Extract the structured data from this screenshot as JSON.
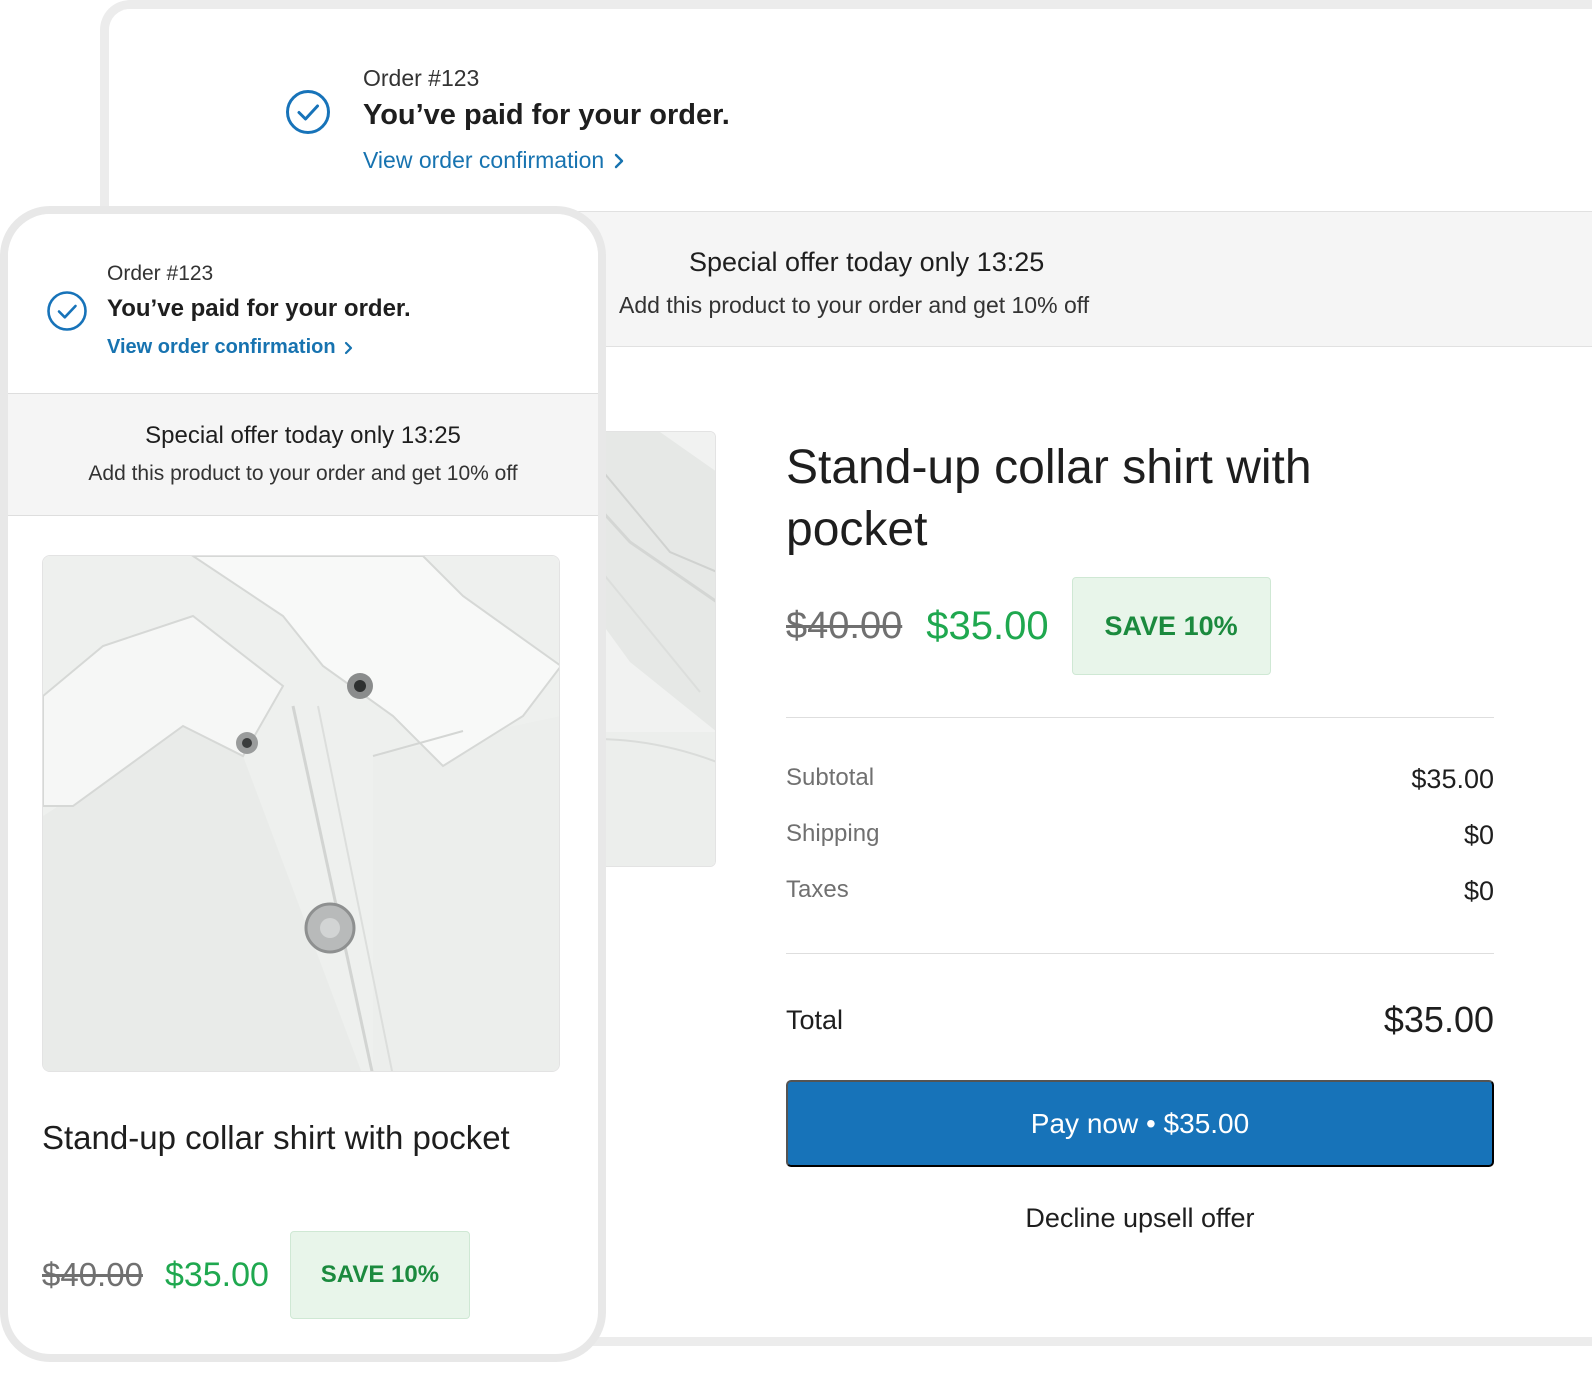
{
  "order": {
    "number": "Order #123",
    "paid_message": "You’ve paid for your order.",
    "confirmation_link": "View order confirmation"
  },
  "offer": {
    "title": "Special offer today only 13:25",
    "subtitle": "Add this product to your order and get 10% off"
  },
  "product": {
    "title": "Stand-up collar shirt with pocket",
    "original_price": "$40.00",
    "sale_price": "$35.00",
    "save_badge": "SAVE 10%"
  },
  "summary": {
    "subtotal_label": "Subtotal",
    "subtotal_value": "$35.00",
    "shipping_label": "Shipping",
    "shipping_value": "$0",
    "taxes_label": "Taxes",
    "taxes_value": "$0",
    "total_label": "Total",
    "total_value": "$35.00"
  },
  "actions": {
    "pay_button": "Pay now • $35.00",
    "decline_link": "Decline upsell offer"
  },
  "colors": {
    "accent_blue": "#1773b9",
    "sale_green": "#1fa84f",
    "badge_bg": "#e8f5ea"
  }
}
